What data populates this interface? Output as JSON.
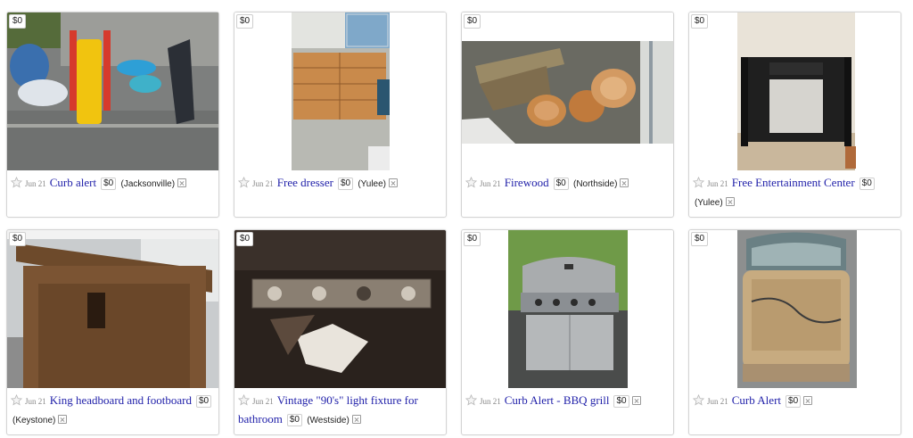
{
  "listings": [
    {
      "price_badge": "$0",
      "date": "Jun 21",
      "title": "Curb alert",
      "price": "$0",
      "location": "(Jacksonville)",
      "star_icon": "star-outline-icon",
      "hide_icon": "hide-x-icon"
    },
    {
      "price_badge": "$0",
      "date": "Jun 21",
      "title": "Free dresser",
      "price": "$0",
      "location": "(Yulee)",
      "star_icon": "star-outline-icon",
      "hide_icon": "hide-x-icon"
    },
    {
      "price_badge": "$0",
      "date": "Jun 21",
      "title": "Firewood",
      "price": "$0",
      "location": "(Northside)",
      "star_icon": "star-outline-icon",
      "hide_icon": "hide-x-icon"
    },
    {
      "price_badge": "$0",
      "date": "Jun 21",
      "title": "Free Entertainment Center",
      "price": "$0",
      "location": "(Yulee)",
      "star_icon": "star-outline-icon",
      "hide_icon": "hide-x-icon"
    },
    {
      "price_badge": "$0",
      "date": "Jun 21",
      "title": "King headboard and footboard",
      "price": "$0",
      "location": "(Keystone)",
      "star_icon": "star-outline-icon",
      "hide_icon": "hide-x-icon"
    },
    {
      "price_badge": "$0",
      "date": "Jun 21",
      "title": "Vintage \"90's\" light fixture for bathroom",
      "price": "$0",
      "location": "(Westside)",
      "star_icon": "star-outline-icon",
      "hide_icon": "hide-x-icon"
    },
    {
      "price_badge": "$0",
      "date": "Jun 21",
      "title": "Curb Alert - BBQ grill",
      "price": "$0",
      "location": "",
      "star_icon": "star-outline-icon",
      "hide_icon": "hide-x-icon"
    },
    {
      "price_badge": "$0",
      "date": "Jun 21",
      "title": "Curb Alert",
      "price": "$0",
      "location": "",
      "star_icon": "star-outline-icon",
      "hide_icon": "hide-x-icon"
    }
  ],
  "colors": {
    "title_link": "#2222aa",
    "card_border": "#d4d4d4",
    "date_gray": "#888888"
  }
}
